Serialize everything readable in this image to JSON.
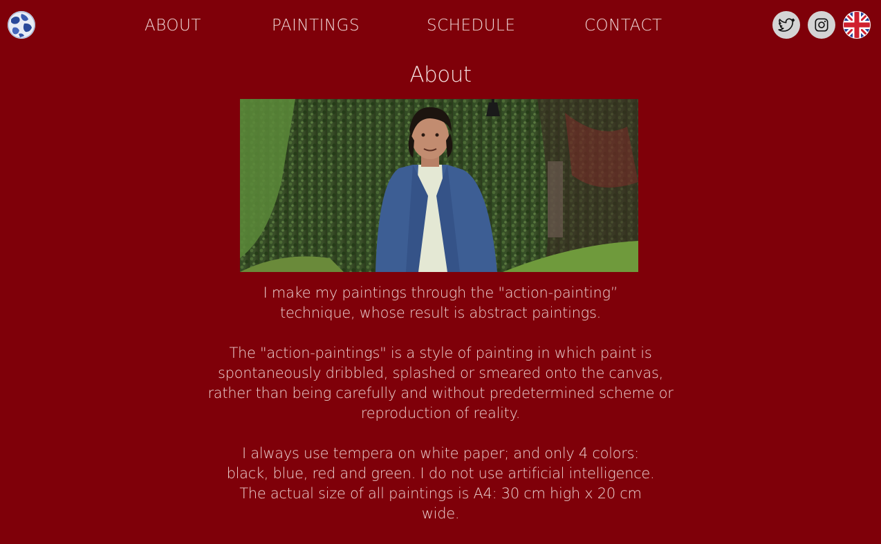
{
  "nav": {
    "items": [
      {
        "label": "ABOUT"
      },
      {
        "label": "PAINTINGS"
      },
      {
        "label": "SCHEDULE"
      },
      {
        "label": "CONTACT"
      }
    ],
    "social": [
      {
        "icon": "twitter-icon"
      },
      {
        "icon": "instagram-icon"
      }
    ],
    "language_icon": "uk-flag-icon",
    "logo_icon": "globe-logo-icon"
  },
  "main": {
    "title": "About",
    "paragraphs": [
      "I make my paintings through the \"action-painting” technique, whose result is abstract paintings.",
      "The \"action-paintings\" is a style of painting in which paint is spontaneously dribbled, splashed or smeared onto the canvas, rather than being carefully and without predetermined scheme or reproduction of reality.",
      "I always use tempera on white paper; and only 4 colors: black, blue, red and green. I do not use artificial intelligence. The actual size of all paintings is A4: 30 cm high x 20 cm wide."
    ]
  },
  "colors": {
    "background": "#7f0009",
    "nav_text": "#f1d9d9",
    "social_bg": "#d4d4d4"
  }
}
